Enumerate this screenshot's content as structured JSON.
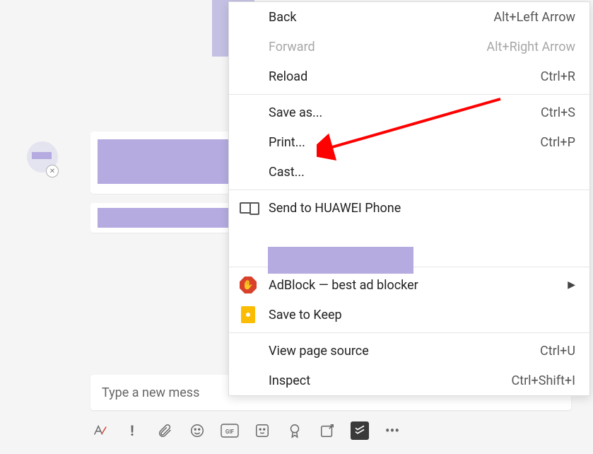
{
  "composer": {
    "placeholder": "Type a new mess"
  },
  "context_menu": {
    "back": {
      "label": "Back",
      "shortcut": "Alt+Left Arrow"
    },
    "forward": {
      "label": "Forward",
      "shortcut": "Alt+Right Arrow"
    },
    "reload": {
      "label": "Reload",
      "shortcut": "Ctrl+R"
    },
    "save_as": {
      "label": "Save as...",
      "shortcut": "Ctrl+S"
    },
    "print": {
      "label": "Print...",
      "shortcut": "Ctrl+P"
    },
    "cast": {
      "label": "Cast..."
    },
    "send_to_phone": {
      "label": "Send to HUAWEI Phone"
    },
    "adblock": {
      "label": "AdBlock — best ad blocker"
    },
    "save_to_keep": {
      "label": "Save to Keep"
    },
    "view_source": {
      "label": "View page source",
      "shortcut": "Ctrl+U"
    },
    "inspect": {
      "label": "Inspect",
      "shortcut": "Ctrl+Shift+I"
    }
  },
  "toolbar_icons": {
    "format": "format-icon",
    "important": "important-icon",
    "attach": "attach-icon",
    "emoji": "emoji-icon",
    "gif": "gif-icon",
    "sticker": "sticker-icon",
    "approval": "approval-icon",
    "new_tab": "new-tab-icon",
    "todoist": "todoist-icon",
    "more": "more-icon"
  },
  "colors": {
    "redact": "#b5abe0",
    "accent_red": "#d9412b",
    "accent_yellow": "#fbbc04"
  }
}
